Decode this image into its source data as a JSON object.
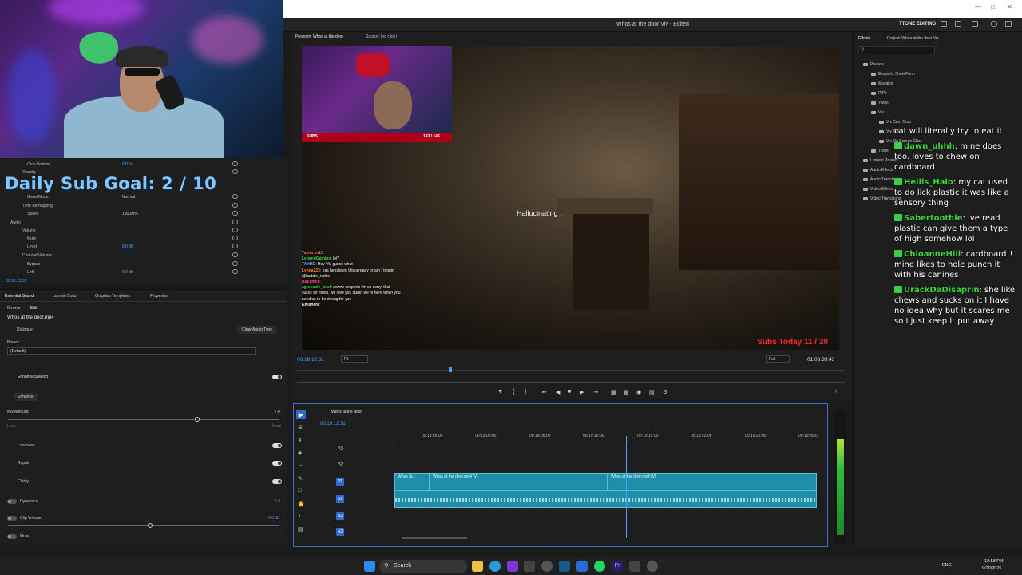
{
  "window": {
    "title": "Whos at the door Viv - Edited",
    "workspace": "TTONE EDITING"
  },
  "overlay": {
    "sub_goal": "Daily Sub Goal:  2 / 10",
    "hallucinating": "Hallucinating :",
    "subs_today": "Subs Today  11 / 20",
    "inset_subs_label": "SUBS",
    "inset_subs_count": "143 / 145"
  },
  "effect_controls": {
    "rows": [
      {
        "label": "Crop Bottom",
        "value": "0.0 %"
      },
      {
        "label": "Opacity",
        "value": ""
      },
      {
        "label": "Blend Mode",
        "value": "Normal"
      },
      {
        "label": "Time Remapping",
        "value": ""
      },
      {
        "label": "Speed",
        "value": "100.00%"
      },
      {
        "label": "Audio",
        "value": ""
      },
      {
        "label": "Volume",
        "value": ""
      },
      {
        "label": "Mute",
        "value": ""
      },
      {
        "label": "Level",
        "value": "0.0 dB"
      },
      {
        "label": "Channel Volume",
        "value": ""
      },
      {
        "label": "Bypass",
        "value": ""
      },
      {
        "label": "Left",
        "value": "0.0 dB"
      }
    ],
    "timecode": "00:19:12:31"
  },
  "essential_sound": {
    "tabs": [
      "Essential Sound",
      "Lumetri Color",
      "Graphics Templates",
      "Properties"
    ],
    "subtabs": [
      "Browse",
      "Edit"
    ],
    "clip_name": "Whos at the door.mp4",
    "dialogue_label": "Dialogue",
    "clear_audio_type": "Clear Audio Type",
    "preset_label": "Preset:",
    "preset_value": "(Default)",
    "enhance_speech": "Enhance Speech",
    "enhance_button": "Enhance",
    "mix_amount": "Mix Amount:",
    "mix_value": "7.0",
    "less": "Less",
    "more": "More",
    "loudness": "Loudness",
    "repair": "Repair",
    "clarity": "Clarity",
    "dynamics": "Dynamics",
    "dynamics_value": "5.0",
    "clip_volume": "Clip Volume",
    "clip_volume_value": "0.0 dB",
    "mute": "Mute"
  },
  "program": {
    "tab_program": "Program: Whos at the door",
    "tab_source": "Source: (no clips)",
    "timecode": "00:19:12:31",
    "fit": "Fit",
    "full": "Full",
    "duration": "01:08:39:43"
  },
  "chat_left": [
    {
      "user": "Tasha_m13",
      "msg": ":"
    },
    {
      "user": "LegendGaming",
      "msg": ": lol*"
    },
    {
      "user": "TAHHD",
      "msg": ": Hey Viv guess what"
    },
    {
      "user": "Lynda123",
      "msg": ": has he played this already or am I trippin"
    },
    {
      "user": "",
      "msg": "@baddie_nattie"
    },
    {
      "user": "BaeThick",
      "msg": ":"
    },
    {
      "user": "",
      "msg": ""
    },
    {
      "user": "",
      "msg": ""
    },
    {
      "user": "agreeable_beef",
      "msg": ": awww exspertz i'm so sorry, that"
    },
    {
      "user": "",
      "msg": "sucks so much. we love you dude, we're here when you"
    },
    {
      "user": "",
      "msg": "need us to be strong for you"
    },
    {
      "user": "KKishere",
      "msg": ":"
    }
  ],
  "timeline": {
    "sequence_name": "Whos at the door",
    "timecode": "00:19:12:31",
    "ruler": [
      "00:18:55:00",
      "00:19:00:00",
      "00:19:05:00",
      "00:19:10:00",
      "00:19:15:00",
      "00:19:20:00",
      "00:19:25:00",
      "00:19:30:0"
    ],
    "tracks": [
      "V3",
      "V2",
      "V1",
      "A1",
      "A2",
      "A3"
    ],
    "clips": [
      "Whos at...",
      "Whos at the door.mp4 [V]",
      "Whos at the door.mp4 [V]"
    ]
  },
  "effects_panel": {
    "tabs": [
      "Effects",
      "Project: Whos at the door Viv"
    ],
    "tree": [
      {
        "label": "Presets",
        "indent": 0
      },
      {
        "label": "Exspertz Short Form",
        "indent": 1
      },
      {
        "label": "Mosaics",
        "indent": 1
      },
      {
        "label": "PIPs",
        "indent": 1
      },
      {
        "label": "Twirls",
        "indent": 1
      },
      {
        "label": "Viv",
        "indent": 1
      },
      {
        "label": "Viv Cam Crop",
        "indent": 2
      },
      {
        "label": "Viv Full",
        "indent": 2
      },
      {
        "label": "Viv On Screen Chat",
        "indent": 2
      },
      {
        "label": "Ttone",
        "indent": 1
      },
      {
        "label": "Lumetri Presets",
        "indent": 0
      },
      {
        "label": "Audio Effects",
        "indent": 0
      },
      {
        "label": "Audio Transitions",
        "indent": 0
      },
      {
        "label": "Video Effects",
        "indent": 0
      },
      {
        "label": "Video Transitions",
        "indent": 0
      }
    ]
  },
  "chat_right": [
    {
      "user": "",
      "msg": "cat will literally try to eat it",
      "color": "#ffffff"
    },
    {
      "user": "dawn_uhhh",
      "msg": ": mine does too. loves to chew on cardboard",
      "color": "#3cd43c"
    },
    {
      "user": "Hellis_Halo",
      "msg": ": my cat used to do lick plastic it was like a sensory thing",
      "color": "#3cd43c"
    },
    {
      "user": "Sabertoothie",
      "msg": ": ive read plastic can give them a type of high somehow lol",
      "color": "#3cd43c"
    },
    {
      "user": "ChloanneHill",
      "msg": ": cardboard!! mine likes to hole punch it with his canines",
      "color": "#3cd43c"
    },
    {
      "user": "UrackDaDisaprin",
      "msg": ": she like chews and sucks on it I have no idea why but it scares me so I just keep it put away",
      "color": "#3cd43c"
    }
  ],
  "taskbar": {
    "search": "Search",
    "lang": "ENG",
    "time": "12:58 PM",
    "date": "9/20/2025"
  }
}
